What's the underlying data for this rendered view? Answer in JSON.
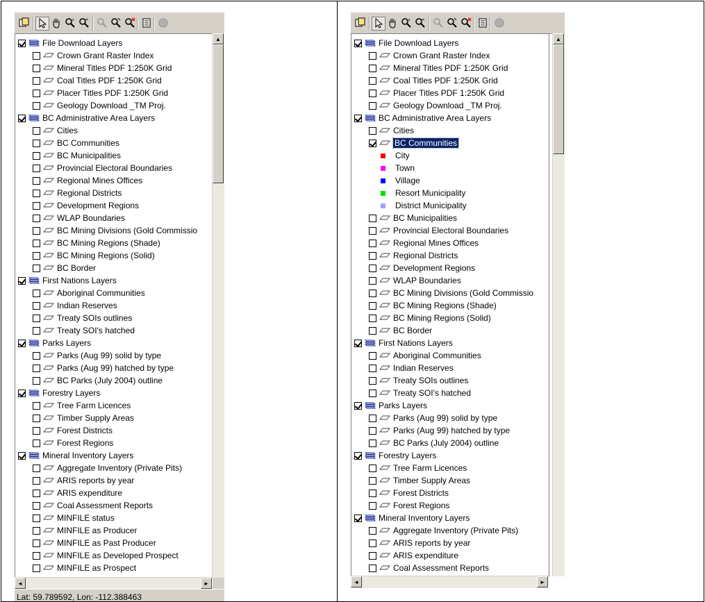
{
  "left_panel": {
    "status_text": "Lat: 59.789592, Lon: -112.388463",
    "rows": [
      {
        "level": 0,
        "checked": true,
        "label": "File Download Layers"
      },
      {
        "level": 1,
        "checked": false,
        "label": "Crown Grant Raster Index"
      },
      {
        "level": 1,
        "checked": false,
        "label": "Mineral Titles PDF 1:250K Grid"
      },
      {
        "level": 1,
        "checked": false,
        "label": "Coal Titles PDF 1:250K Grid"
      },
      {
        "level": 1,
        "checked": false,
        "label": "Placer Titles PDF 1:250K Grid"
      },
      {
        "level": 1,
        "checked": false,
        "label": "Geology Download _TM Proj."
      },
      {
        "level": 0,
        "checked": true,
        "label": "BC Administrative Area Layers"
      },
      {
        "level": 1,
        "checked": false,
        "label": "Cities"
      },
      {
        "level": 1,
        "checked": false,
        "label": "BC Communities"
      },
      {
        "level": 1,
        "checked": false,
        "label": "BC Municipalities"
      },
      {
        "level": 1,
        "checked": false,
        "label": "Provincial Electoral Boundaries"
      },
      {
        "level": 1,
        "checked": false,
        "label": "Regional Mines Offices"
      },
      {
        "level": 1,
        "checked": false,
        "label": "Regional Districts"
      },
      {
        "level": 1,
        "checked": false,
        "label": "Development Regions"
      },
      {
        "level": 1,
        "checked": false,
        "label": "WLAP Boundaries"
      },
      {
        "level": 1,
        "checked": false,
        "label": "BC Mining Divisions (Gold Commissio"
      },
      {
        "level": 1,
        "checked": false,
        "label": "BC Mining Regions (Shade)"
      },
      {
        "level": 1,
        "checked": false,
        "label": "BC Mining Regions (Solid)"
      },
      {
        "level": 1,
        "checked": false,
        "label": "BC Border"
      },
      {
        "level": 0,
        "checked": true,
        "label": "First Nations Layers"
      },
      {
        "level": 1,
        "checked": false,
        "label": "Aboriginal Communities"
      },
      {
        "level": 1,
        "checked": false,
        "label": "Indian Reserves"
      },
      {
        "level": 1,
        "checked": false,
        "label": "Treaty SOIs outlines"
      },
      {
        "level": 1,
        "checked": false,
        "label": "Treaty SOI's hatched"
      },
      {
        "level": 0,
        "checked": true,
        "label": "Parks Layers"
      },
      {
        "level": 1,
        "checked": false,
        "label": "Parks (Aug 99) solid by type"
      },
      {
        "level": 1,
        "checked": false,
        "label": "Parks (Aug 99) hatched by type"
      },
      {
        "level": 1,
        "checked": false,
        "label": "BC Parks (July 2004) outline"
      },
      {
        "level": 0,
        "checked": true,
        "label": "Forestry Layers"
      },
      {
        "level": 1,
        "checked": false,
        "label": "Tree Farm Licences"
      },
      {
        "level": 1,
        "checked": false,
        "label": "Timber Supply Areas"
      },
      {
        "level": 1,
        "checked": false,
        "label": "Forest Districts"
      },
      {
        "level": 1,
        "checked": false,
        "label": "Forest Regions"
      },
      {
        "level": 0,
        "checked": true,
        "label": "Mineral Inventory Layers"
      },
      {
        "level": 1,
        "checked": false,
        "label": "Aggregate Inventory (Private Pits)"
      },
      {
        "level": 1,
        "checked": false,
        "label": "ARIS reports by year"
      },
      {
        "level": 1,
        "checked": false,
        "label": "ARIS expenditure"
      },
      {
        "level": 1,
        "checked": false,
        "label": "Coal Assessment Reports"
      },
      {
        "level": 1,
        "checked": false,
        "label": "MINFILE status"
      },
      {
        "level": 1,
        "checked": false,
        "label": "MINFILE as Producer"
      },
      {
        "level": 1,
        "checked": false,
        "label": "MINFILE as Past Producer"
      },
      {
        "level": 1,
        "checked": false,
        "label": "MINFILE as Developed Prospect"
      },
      {
        "level": 1,
        "checked": false,
        "label": "MINFILE as Prospect"
      }
    ]
  },
  "right_panel": {
    "rows": [
      {
        "level": 0,
        "checked": true,
        "label": "File Download Layers"
      },
      {
        "level": 1,
        "checked": false,
        "label": "Crown Grant Raster Index"
      },
      {
        "level": 1,
        "checked": false,
        "label": "Mineral Titles PDF 1:250K Grid"
      },
      {
        "level": 1,
        "checked": false,
        "label": "Coal Titles PDF 1:250K Grid"
      },
      {
        "level": 1,
        "checked": false,
        "label": "Placer Titles PDF 1:250K Grid"
      },
      {
        "level": 1,
        "checked": false,
        "label": "Geology Download _TM Proj."
      },
      {
        "level": 0,
        "checked": true,
        "label": "BC Administrative Area Layers"
      },
      {
        "level": 1,
        "checked": false,
        "label": "Cities"
      },
      {
        "level": 1,
        "checked": true,
        "label": "BC Communities",
        "selected": true
      },
      {
        "level": 2,
        "legend": true,
        "color": "#ff0000",
        "label": "City"
      },
      {
        "level": 2,
        "legend": true,
        "color": "#ff00ff",
        "label": "Town"
      },
      {
        "level": 2,
        "legend": true,
        "color": "#0000ff",
        "label": "Village"
      },
      {
        "level": 2,
        "legend": true,
        "color": "#00e000",
        "label": "Resort Municipality"
      },
      {
        "level": 2,
        "legend": true,
        "color": "#a0a0ff",
        "label": "District Municipality"
      },
      {
        "level": 1,
        "checked": false,
        "label": "BC Municipalities"
      },
      {
        "level": 1,
        "checked": false,
        "label": "Provincial Electoral Boundaries"
      },
      {
        "level": 1,
        "checked": false,
        "label": "Regional Mines Offices"
      },
      {
        "level": 1,
        "checked": false,
        "label": "Regional Districts"
      },
      {
        "level": 1,
        "checked": false,
        "label": "Development Regions"
      },
      {
        "level": 1,
        "checked": false,
        "label": "WLAP Boundaries"
      },
      {
        "level": 1,
        "checked": false,
        "label": "BC Mining Divisions (Gold Commissio"
      },
      {
        "level": 1,
        "checked": false,
        "label": "BC Mining Regions (Shade)"
      },
      {
        "level": 1,
        "checked": false,
        "label": "BC Mining Regions (Solid)"
      },
      {
        "level": 1,
        "checked": false,
        "label": "BC Border"
      },
      {
        "level": 0,
        "checked": true,
        "label": "First Nations Layers"
      },
      {
        "level": 1,
        "checked": false,
        "label": "Aboriginal Communities"
      },
      {
        "level": 1,
        "checked": false,
        "label": "Indian Reserves"
      },
      {
        "level": 1,
        "checked": false,
        "label": "Treaty SOIs outlines"
      },
      {
        "level": 1,
        "checked": false,
        "label": "Treaty SOI's hatched"
      },
      {
        "level": 0,
        "checked": true,
        "label": "Parks Layers"
      },
      {
        "level": 1,
        "checked": false,
        "label": "Parks (Aug 99) solid by type"
      },
      {
        "level": 1,
        "checked": false,
        "label": "Parks (Aug 99) hatched by type"
      },
      {
        "level": 1,
        "checked": false,
        "label": "BC Parks (July 2004) outline"
      },
      {
        "level": 0,
        "checked": true,
        "label": "Forestry Layers"
      },
      {
        "level": 1,
        "checked": false,
        "label": "Tree Farm Licences"
      },
      {
        "level": 1,
        "checked": false,
        "label": "Timber Supply Areas"
      },
      {
        "level": 1,
        "checked": false,
        "label": "Forest Districts"
      },
      {
        "level": 1,
        "checked": false,
        "label": "Forest Regions"
      },
      {
        "level": 0,
        "checked": true,
        "label": "Mineral Inventory Layers"
      },
      {
        "level": 1,
        "checked": false,
        "label": "Aggregate Inventory (Private Pits)"
      },
      {
        "level": 1,
        "checked": false,
        "label": "ARIS reports by year"
      },
      {
        "level": 1,
        "checked": false,
        "label": "ARIS expenditure"
      },
      {
        "level": 1,
        "checked": false,
        "label": "Coal Assessment Reports"
      }
    ]
  },
  "toolbar_icons": [
    "copy-layers-icon",
    "select-arrow-icon",
    "pan-hand-icon",
    "zoom-in-icon",
    "zoom-out-icon",
    "zoom-previous-icon",
    "zoom-extent-icon",
    "zoom-clear-icon",
    "legend-icon",
    "stop-icon"
  ],
  "scroll_label_up": "▲",
  "scroll_label_down": "▼",
  "scroll_label_left": "◄",
  "scroll_label_right": "►"
}
